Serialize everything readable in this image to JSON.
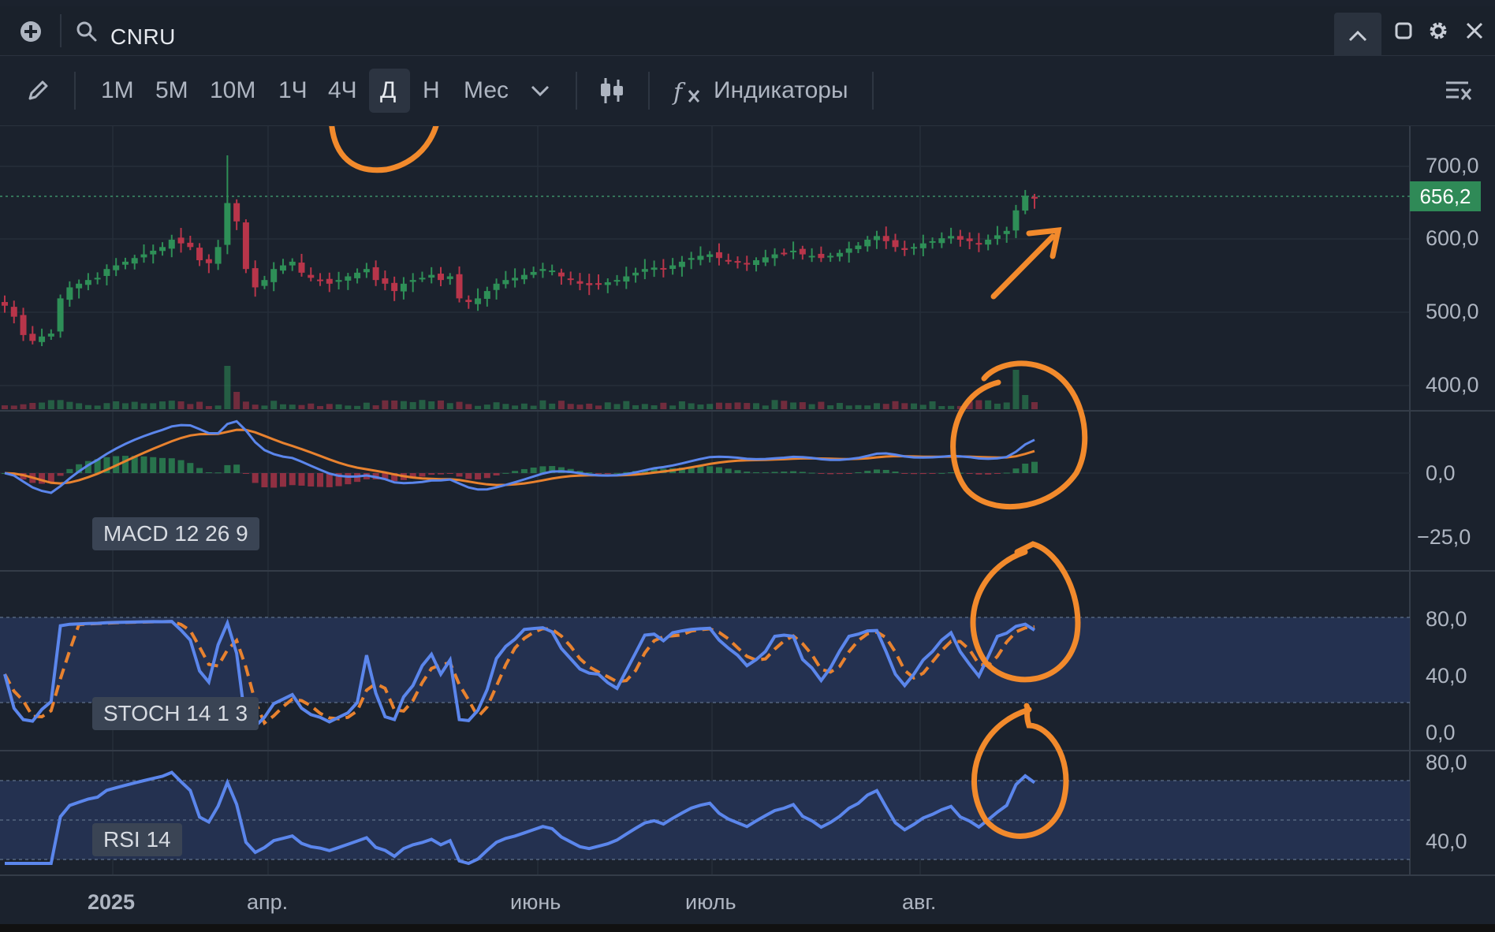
{
  "titlebar": {
    "ticker": "CNRU",
    "add_icon": "plus-circle-icon",
    "search_icon": "search-icon",
    "collapse_icon": "chevron-up-icon",
    "window_icon": "square-icon",
    "settings_icon": "gear-icon",
    "close_icon": "close-icon"
  },
  "toolbar": {
    "draw_icon": "pencil-icon",
    "timeframes": [
      "1М",
      "5М",
      "10М",
      "1Ч",
      "4Ч",
      "Д",
      "Н",
      "Мес"
    ],
    "active_timeframe": "Д",
    "more_icon": "chevron-down-icon",
    "chart_type_icon": "candles-icon",
    "indicators_icon": "fx-icon",
    "indicators_label": "Индикаторы",
    "clear_icon": "clear-list-icon"
  },
  "price_axis": [
    "700,0",
    "600,0",
    "500,0",
    "400,0"
  ],
  "last_price": "656,2",
  "macd_axis": [
    "0,0",
    "−25,0"
  ],
  "stoch_axis": [
    "80,0",
    "40,0",
    "0,0"
  ],
  "rsi_axis": [
    "80,0",
    "40,0"
  ],
  "panes": {
    "macd": "MACD 12 26 9",
    "stoch": "STOCH 14 1 3",
    "rsi": "RSI 14"
  },
  "dates": [
    "2025",
    "апр.",
    "июнь",
    "июль",
    "авг."
  ],
  "colors": {
    "up": "#2e8f57",
    "down": "#b8354a",
    "blue_line": "#5b86ec",
    "orange_line": "#e8822f",
    "annotation": "#f28a2c"
  },
  "chart_data": {
    "type": "candlestick",
    "ylim": [
      380,
      720
    ],
    "last": 656.2,
    "close_series": [
      510,
      495,
      470,
      462,
      468,
      472,
      520,
      535,
      540,
      545,
      548,
      560,
      565,
      570,
      575,
      580,
      585,
      590,
      600,
      595,
      590,
      572,
      568,
      590,
      650,
      625,
      560,
      535,
      545,
      560,
      565,
      570,
      555,
      548,
      545,
      540,
      545,
      550,
      555,
      560,
      545,
      540,
      530,
      540,
      545,
      548,
      552,
      545,
      550,
      520,
      515,
      520,
      530,
      540,
      545,
      548,
      552,
      556,
      560,
      558,
      550,
      545,
      540,
      538,
      540,
      542,
      545,
      550,
      555,
      560,
      562,
      560,
      565,
      570,
      575,
      578,
      580,
      575,
      572,
      570,
      568,
      572,
      576,
      580,
      582,
      585,
      580,
      578,
      575,
      578,
      582,
      588,
      592,
      600,
      605,
      598,
      590,
      586,
      590,
      595,
      598,
      602,
      605,
      600,
      598,
      595,
      600,
      606,
      612,
      640,
      660,
      656
    ]
  }
}
